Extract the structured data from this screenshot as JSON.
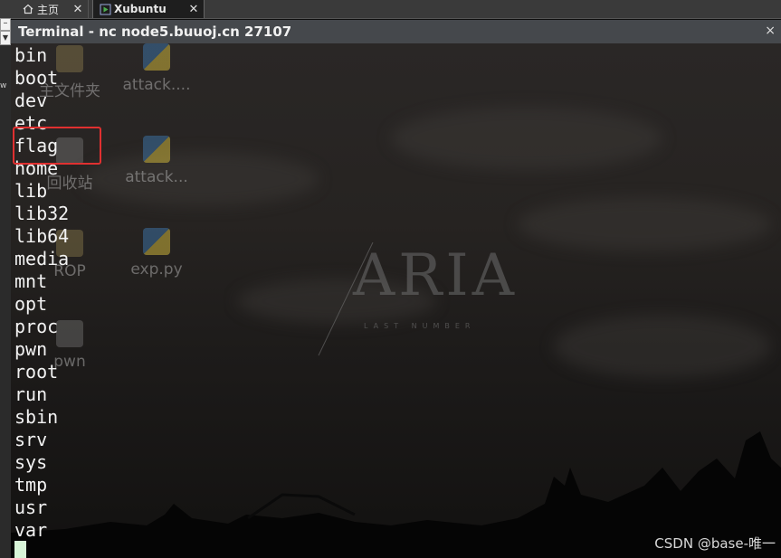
{
  "tabs": [
    {
      "label": "主页",
      "icon": "home-icon",
      "active": false
    },
    {
      "label": "Xubuntu",
      "icon": "vm-play-icon",
      "active": true
    }
  ],
  "window": {
    "title": "Terminal - nc node5.buuoj.cn 27107"
  },
  "terminal": {
    "lines": [
      "bin",
      "boot",
      "dev",
      "etc",
      "flag",
      "home",
      "lib",
      "lib32",
      "lib64",
      "media",
      "mnt",
      "opt",
      "proc",
      "pwn",
      "root",
      "run",
      "sbin",
      "srv",
      "sys",
      "tmp",
      "usr",
      "var"
    ],
    "highlighted_entry": "flag",
    "highlight_color": "#e03030",
    "text_color": "#f2f2f2",
    "cursor_color": "#d8f5d8"
  },
  "desktop": {
    "icons": [
      {
        "label": "主文件夹",
        "icon": "folder-icon"
      },
      {
        "label": "attack....",
        "icon": "python-file-icon"
      },
      {
        "label": "回收站",
        "icon": "trash-icon"
      },
      {
        "label": "attack...",
        "icon": "python-file-icon"
      },
      {
        "label": "ROP",
        "icon": "folder-icon"
      },
      {
        "label": "exp.py",
        "icon": "python-file-icon"
      },
      {
        "label": "pwn",
        "icon": "executable-icon"
      }
    ],
    "wallpaper": {
      "logo_text": "ARIA",
      "logo_subtext": "LAST NUMBER"
    }
  },
  "watermark": "CSDN @base-唯一"
}
